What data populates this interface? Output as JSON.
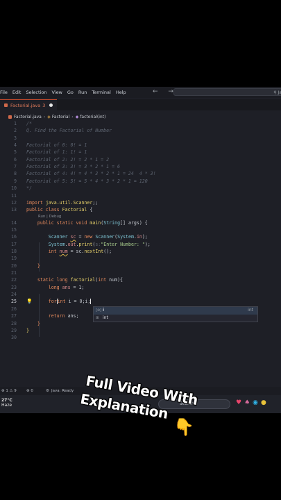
{
  "menubar": {
    "items": [
      "File",
      "Edit",
      "Selection",
      "View",
      "Go",
      "Run",
      "Terminal",
      "Help"
    ],
    "nav": "← →",
    "search_text": "Ja"
  },
  "tab": {
    "label": "Factorial.java",
    "count": "3"
  },
  "breadcrumb": {
    "file": "Factorial.java",
    "class": "Factorial",
    "method": "factorial(int)"
  },
  "codelens": "Run | Debug",
  "suggest": {
    "items": [
      {
        "icon": "[⊘]",
        "label": "i",
        "detail": "int"
      },
      {
        "icon": "⊞",
        "label": "int",
        "detail": ""
      }
    ]
  },
  "statusbar": {
    "problems": "⊗ 1 ⚠ 9",
    "ports": "⊗ 0",
    "java": "Java: Ready"
  },
  "taskbar": {
    "temp": "27°C",
    "weather": "Haze",
    "search": "Search"
  },
  "overlay": {
    "line1": "Full Video With",
    "line2": "Explanation"
  }
}
